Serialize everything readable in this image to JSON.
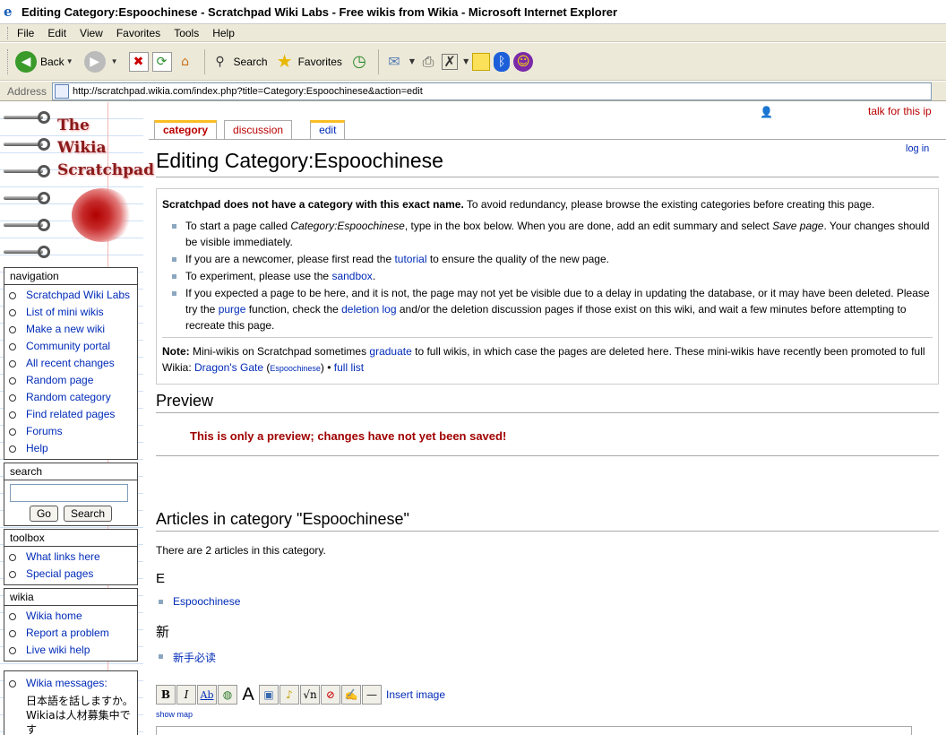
{
  "window": {
    "title": "Editing Category:Espoochinese - Scratchpad Wiki Labs - Free wikis from Wikia - Microsoft Internet Explorer"
  },
  "menu": [
    "File",
    "Edit",
    "View",
    "Favorites",
    "Tools",
    "Help"
  ],
  "toolbar": {
    "back": "Back",
    "search": "Search",
    "favorites": "Favorites"
  },
  "address": {
    "label": "Address",
    "url": "http://scratchpad.wikia.com/index.php?title=Category:Espoochinese&action=edit"
  },
  "logo": {
    "lines": [
      "The",
      "Wikia",
      "Scratchpad"
    ]
  },
  "navigation": {
    "title": "navigation",
    "items": [
      "Scratchpad Wiki Labs",
      "List of mini wikis",
      "Make a new wiki",
      "Community portal",
      "All recent changes",
      "Random page",
      "Random category",
      "Find related pages",
      "Forums",
      "Help"
    ]
  },
  "search": {
    "title": "search",
    "go": "Go",
    "search": "Search"
  },
  "toolbox": {
    "title": "toolbox",
    "items": [
      "What links here",
      "Special pages"
    ]
  },
  "wikia": {
    "title": "wikia",
    "items": [
      "Wikia home",
      "Report a problem",
      "Live wiki help"
    ]
  },
  "messages": {
    "label": "Wikia messages:",
    "text": "日本語を話しますか。Wikiaは人材募集中です"
  },
  "tabs": {
    "category": "category",
    "discussion": "discussion",
    "edit": "edit"
  },
  "user": {
    "talk": "talk for this ip",
    "login": "log in"
  },
  "page": {
    "title": "Editing Category:Espoochinese"
  },
  "notice": {
    "bold": "Scratchpad does not have a category with this exact name.",
    "intro_rest": " To avoid redundancy, please browse the existing categories before creating this page.",
    "li1_a": "To start a page called ",
    "li1_i": "Category:Espoochinese",
    "li1_b": ", type in the box below. When you are done, add an edit summary and select ",
    "li1_i2": "Save page",
    "li1_c": ". Your changes should be visible immediately.",
    "li2_a": "If you are a newcomer, please first read the ",
    "li2_link": "tutorial",
    "li2_b": " to ensure the quality of the new page.",
    "li3_a": "To experiment, please use the ",
    "li3_link": "sandbox",
    "li3_b": ".",
    "li4_a": "If you expected a page to be here, and it is not, the page may not yet be visible due to a delay in updating the database, or it may have been deleted. Please try the ",
    "li4_link1": "purge",
    "li4_b": " function, check the ",
    "li4_link2": "deletion log",
    "li4_c": " and/or the deletion discussion pages if those exist on this wiki, and wait a few minutes before attempting to recreate this page.",
    "note_bold": "Note:",
    "note_a": " Mini-wikis on Scratchpad sometimes ",
    "note_link": "graduate",
    "note_b": " to full wikis, in which case the pages are deleted here. These mini-wikis have recently been promoted to full Wikia: ",
    "note_link2": "Dragon's Gate",
    "note_paren_open": " (",
    "note_small": "Espoochinese",
    "note_paren_close": ") • ",
    "note_link3": "full list"
  },
  "preview": {
    "heading": "Preview",
    "note": "This is only a preview; changes have not yet been saved!"
  },
  "articles": {
    "heading": "Articles in category \"Espoochinese\"",
    "count": "There are 2 articles in this category.",
    "groups": [
      {
        "letter": "E",
        "item": "Espoochinese"
      },
      {
        "letter": "新",
        "item": "新手必读"
      }
    ]
  },
  "editor": {
    "insert_image": "Insert image",
    "show_map": "show map"
  }
}
